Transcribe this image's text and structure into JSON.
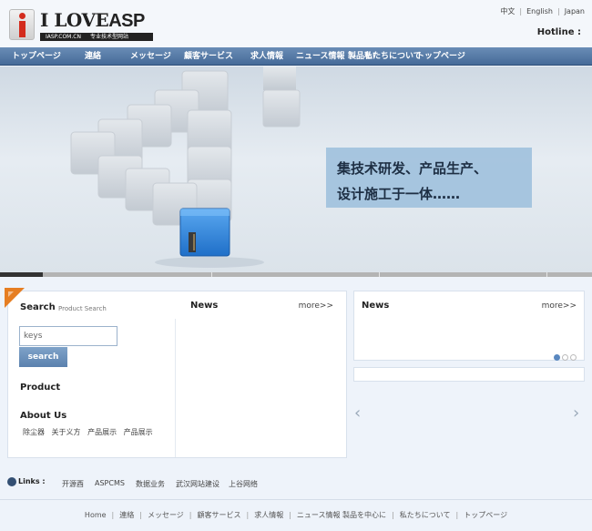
{
  "header": {
    "logo": {
      "main": "I LOVE",
      "brand": "ASP",
      "domain": "IASP.COM.CN",
      "slogan": "专业技术型网站"
    },
    "languages": [
      "中文",
      "English",
      "Japan"
    ],
    "hotline": "Hotline :"
  },
  "nav": {
    "items": [
      "トップページ",
      "連絡",
      "メッセージ",
      "顧客サービス",
      "求人情報",
      "ニュース情報",
      "製品を中心に",
      "私たちについて",
      "トップページ"
    ]
  },
  "banner": {
    "caption_line1": "集技术研发、产品生产、",
    "caption_line2": "设计施工于一体……",
    "slide_index": 1,
    "slide_count": 4
  },
  "search": {
    "title": "Search",
    "subtitle": "Product Search",
    "input_value": "keys",
    "button_label": "search"
  },
  "product": {
    "title": "Product"
  },
  "about": {
    "title": "About Us",
    "links": [
      "除尘器",
      "关于义方",
      "产品展示",
      "产品展示"
    ]
  },
  "news_left": {
    "title": "News",
    "more": "more>>"
  },
  "news_right": {
    "title": "News",
    "more": "more>>",
    "dots": 3,
    "active_dot": 1
  },
  "links": {
    "label": "Links :",
    "items": [
      "开源酉",
      "ASPCMS",
      "数据业务",
      "武汉网站建设",
      "上谷网络"
    ]
  },
  "footer": {
    "items": [
      "Home",
      "連絡",
      "メッセージ",
      "顧客サービス",
      "求人情報",
      "ニュース情報 製品を中心に",
      "私たちについて",
      "トップページ"
    ]
  },
  "colors": {
    "nav": "#456a98",
    "accent": "#e67e22",
    "button": "#6a8fbb"
  }
}
